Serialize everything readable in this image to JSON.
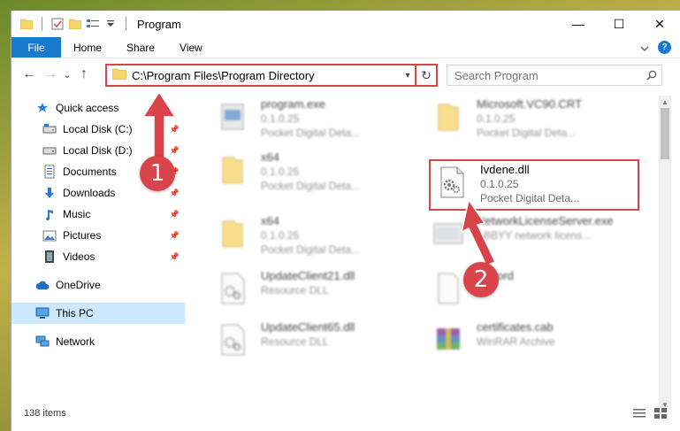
{
  "window": {
    "title": "Program",
    "controls": {
      "minimize": "—",
      "maximize": "☐",
      "close": "✕"
    }
  },
  "ribbon": {
    "tabs": [
      {
        "label": "File"
      },
      {
        "label": "Home"
      },
      {
        "label": "Share"
      },
      {
        "label": "View"
      }
    ],
    "expand_icon": "chevron-down-icon",
    "help_label": "?"
  },
  "nav": {
    "back": "←",
    "forward": "→",
    "dropdown": "⌄",
    "up": "↑",
    "address": "C:\\Program Files\\Program Directory",
    "address_drop": "▾",
    "refresh": "↻",
    "search_placeholder": "Search Program"
  },
  "sidebar": {
    "items": [
      {
        "label": "Quick access",
        "icon": "star-icon"
      },
      {
        "label": "Local Disk (C:)",
        "icon": "drive-icon",
        "pinned": true
      },
      {
        "label": "Local Disk (D:)",
        "icon": "drive-icon",
        "pinned": true
      },
      {
        "label": "Documents",
        "icon": "documents-icon",
        "pinned": true
      },
      {
        "label": "Downloads",
        "icon": "downloads-icon",
        "pinned": true
      },
      {
        "label": "Music",
        "icon": "music-icon",
        "pinned": true
      },
      {
        "label": "Pictures",
        "icon": "pictures-icon",
        "pinned": true
      },
      {
        "label": "Videos",
        "icon": "videos-icon",
        "pinned": true
      },
      {
        "label": "OneDrive",
        "icon": "cloud-icon"
      },
      {
        "label": "This PC",
        "icon": "computer-icon",
        "selected": true
      },
      {
        "label": "Network",
        "icon": "network-icon"
      }
    ]
  },
  "files": [
    {
      "name": "program.exe",
      "line2": "0.1.0.25",
      "line3": "Pocket Digital Deta...",
      "icon": "exe-icon"
    },
    {
      "name": "Microsoft.VC90.CRT",
      "line2": "0.1.0.25",
      "line3": "Pocket Digital Deta...",
      "icon": "folder-icon"
    },
    {
      "name": "x64",
      "line2": "0.1.0.25",
      "line3": "Pocket Digital Deta...",
      "icon": "folder-icon"
    },
    {
      "name": "Ivdene.dll",
      "line2": "0.1.0.25",
      "line3": "Pocket Digital Deta...",
      "icon": "dll-gear-icon"
    },
    {
      "name": "x64",
      "line2": "0.1.0.25",
      "line3": "Pocket Digital Deta...",
      "icon": "folder-icon"
    },
    {
      "name": "NetworkLicenseServer.exe",
      "line2": "ABBYY network licens...",
      "line3": "",
      "icon": "exe-icon"
    },
    {
      "name": "UpdateClient21.dll",
      "line2": "Resource DLL",
      "line3": "",
      "icon": "dll-gear-icon"
    },
    {
      "name": "Record",
      "line2": "File",
      "line3": "",
      "icon": "file-icon"
    },
    {
      "name": "UpdateClient65.dll",
      "line2": "Resource DLL",
      "line3": "",
      "icon": "dll-gear-icon"
    },
    {
      "name": "certificates.cab",
      "line2": "WinRAR Archive",
      "line3": "",
      "icon": "archive-icon"
    }
  ],
  "status": {
    "items_count": "138 items"
  },
  "annotations": {
    "step1": "1",
    "step2": "2"
  },
  "colors": {
    "accent": "#1979ca",
    "highlight": "#d9434a",
    "selected": "#cce8ff"
  }
}
